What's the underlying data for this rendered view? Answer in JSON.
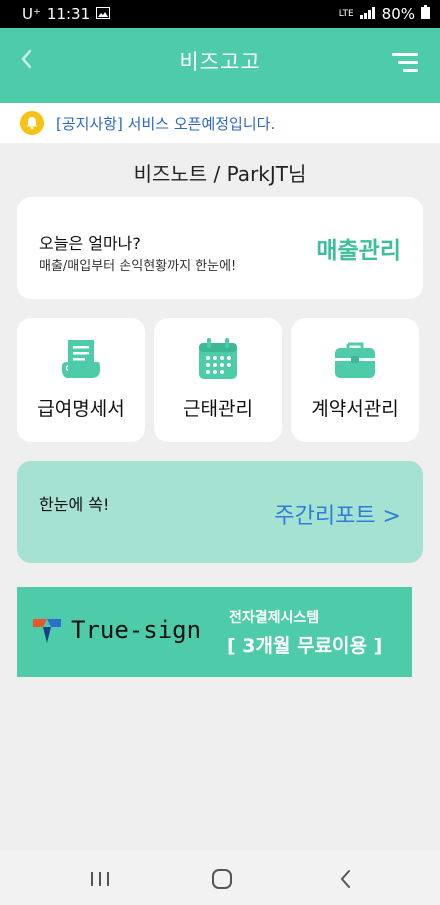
{
  "status": {
    "carrier": "U⁺",
    "time": "11:31",
    "network": "LTE",
    "battery": "80%"
  },
  "header": {
    "title": "비즈고고"
  },
  "notice": {
    "text": "[공지사항] 서비스 오픈예정입니다."
  },
  "greeting": "비즈노트 / ParkJT님",
  "sales": {
    "question": "오늘은 얼마나?",
    "subtitle": "매출/매입부터 손익현황까지 한눈에!",
    "button": "매출관리"
  },
  "tiles": [
    {
      "label": "급여명세서",
      "icon": "payslip-icon"
    },
    {
      "label": "근태관리",
      "icon": "calendar-icon"
    },
    {
      "label": "계약서관리",
      "icon": "briefcase-icon"
    }
  ],
  "weekly": {
    "text": "한눈에 쏙!",
    "button": "주간리포트 >"
  },
  "banner": {
    "brand": "True-sign",
    "line1": "전자결제시스템",
    "line2": "[ 3개월 무료이용 ]"
  },
  "colors": {
    "primary": "#4ecba9",
    "accent_text": "#3cc09c",
    "link_blue": "#2e7dd6",
    "notice_blue": "#2a67c8",
    "bell": "#f7c214"
  }
}
